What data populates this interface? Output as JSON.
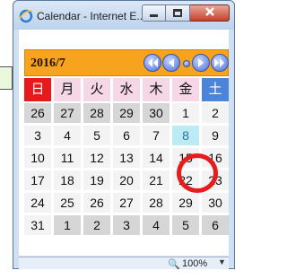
{
  "window": {
    "title": "Calendar - Internet E..."
  },
  "calendar": {
    "month_label": "2016/7",
    "weekdays": [
      "日",
      "月",
      "火",
      "水",
      "木",
      "金",
      "土"
    ],
    "rows": [
      [
        {
          "day": "26",
          "state": "gray"
        },
        {
          "day": "27",
          "state": "gray"
        },
        {
          "day": "28",
          "state": "gray"
        },
        {
          "day": "29",
          "state": "gray"
        },
        {
          "day": "30",
          "state": "gray"
        },
        {
          "day": "1",
          "state": "normal"
        },
        {
          "day": "2",
          "state": "normal"
        }
      ],
      [
        {
          "day": "3",
          "state": "normal"
        },
        {
          "day": "4",
          "state": "normal"
        },
        {
          "day": "5",
          "state": "normal"
        },
        {
          "day": "6",
          "state": "normal"
        },
        {
          "day": "7",
          "state": "normal"
        },
        {
          "day": "8",
          "state": "today"
        },
        {
          "day": "9",
          "state": "normal"
        }
      ],
      [
        {
          "day": "10",
          "state": "normal"
        },
        {
          "day": "11",
          "state": "normal"
        },
        {
          "day": "12",
          "state": "normal"
        },
        {
          "day": "13",
          "state": "normal"
        },
        {
          "day": "14",
          "state": "normal"
        },
        {
          "day": "15",
          "state": "normal"
        },
        {
          "day": "16",
          "state": "normal"
        }
      ],
      [
        {
          "day": "17",
          "state": "normal"
        },
        {
          "day": "18",
          "state": "normal"
        },
        {
          "day": "19",
          "state": "normal"
        },
        {
          "day": "20",
          "state": "normal"
        },
        {
          "day": "21",
          "state": "normal"
        },
        {
          "day": "22",
          "state": "normal"
        },
        {
          "day": "23",
          "state": "normal"
        }
      ],
      [
        {
          "day": "24",
          "state": "normal"
        },
        {
          "day": "25",
          "state": "normal"
        },
        {
          "day": "26",
          "state": "normal"
        },
        {
          "day": "27",
          "state": "normal"
        },
        {
          "day": "28",
          "state": "normal"
        },
        {
          "day": "29",
          "state": "normal"
        },
        {
          "day": "30",
          "state": "normal"
        }
      ],
      [
        {
          "day": "31",
          "state": "normal"
        },
        {
          "day": "1",
          "state": "gray"
        },
        {
          "day": "2",
          "state": "gray"
        },
        {
          "day": "3",
          "state": "gray"
        },
        {
          "day": "4",
          "state": "gray"
        },
        {
          "day": "5",
          "state": "gray"
        },
        {
          "day": "6",
          "state": "gray"
        }
      ]
    ]
  },
  "status": {
    "zoom": "100%"
  },
  "icons": [
    "ie-logo-icon",
    "minimize-icon",
    "maximize-icon",
    "close-icon",
    "first-icon",
    "prev-icon",
    "today-dot-icon",
    "next-icon",
    "last-icon",
    "zoom-icon",
    "dropdown-arrow-icon"
  ],
  "colors": {
    "header": "#f8a31d",
    "sunday": "#e8191a",
    "saturday": "#4c84d9",
    "weekday_header": "#f6d7e6",
    "outside_month": "#d6d6d6",
    "today": "#bdebf3",
    "highlight_circle": "#e71d1d"
  }
}
